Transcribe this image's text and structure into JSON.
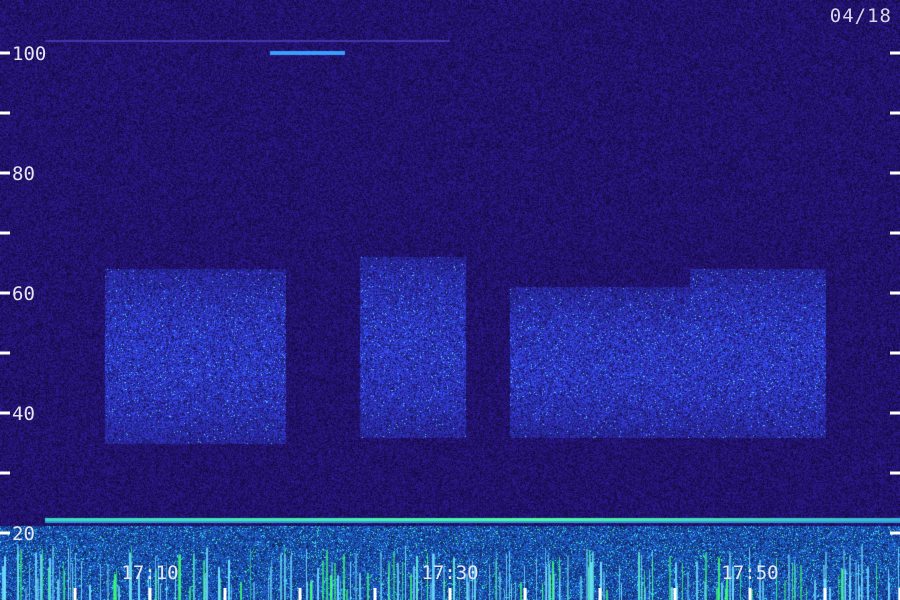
{
  "date_label": "04/18",
  "colors": {
    "background": "#160c46",
    "noise": "#2a1a8a",
    "band": "#2a55ff",
    "highlight": "#6fe0ff",
    "green": "#3dff7a",
    "axis": "#ffffff"
  },
  "chart_data": {
    "type": "heatmap",
    "title": "",
    "xlabel": "",
    "ylabel": "",
    "ylim": [
      16,
      108
    ],
    "yticks_labeled": [
      20,
      40,
      60,
      80,
      100
    ],
    "yticks_minor": [
      30,
      50,
      70,
      90
    ],
    "xlim": [
      "17:03",
      "17:62"
    ],
    "xticks_labeled": [
      "17:10",
      "17:30",
      "17:50"
    ],
    "x_tick_interval_minutes": 5,
    "activity_bands": [
      {
        "start": "17:07",
        "end": "17:19",
        "low": 35,
        "high": 64
      },
      {
        "start": "17:24",
        "end": "17:31",
        "low": 36,
        "high": 66
      },
      {
        "start": "17:34",
        "end": "17:40",
        "low": 36,
        "high": 61
      },
      {
        "start": "17:40",
        "end": "17:46",
        "low": 36,
        "high": 61
      },
      {
        "start": "17:46",
        "end": "17:55",
        "low": 36,
        "high": 64
      }
    ],
    "line_features": [
      {
        "value": 100,
        "start": "17:18",
        "end": "17:23"
      },
      {
        "value": 102,
        "start": "17:03",
        "end": "17:30"
      },
      {
        "value": 22,
        "start": "17:03",
        "end": "17:62"
      }
    ]
  }
}
